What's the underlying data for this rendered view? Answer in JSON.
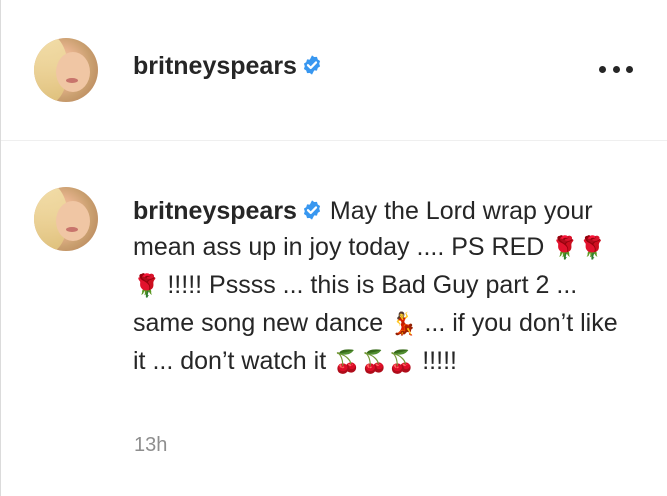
{
  "post_header": {
    "username": "britneyspears",
    "verified": true,
    "more_icon": "more-options-icon"
  },
  "comment": {
    "username": "britneyspears",
    "verified": true,
    "text_part1": "May the Lord wrap your mean ass up in joy today .... PS RED ",
    "emoji_roses": "🌹🌹🌹",
    "text_part2": " !!!!! Pssss ... this is Bad Guy part 2 ... same song new dance ",
    "emoji_dancer": "💃",
    "text_part3": " ... if you don’t like it ... don’t watch it ",
    "emoji_cherries": "🍒🍒🍒",
    "text_part4": " !!!!!",
    "timestamp": "13h"
  },
  "colors": {
    "verified_badge": "#3897f0",
    "text": "#262626",
    "muted": "#8e8e8e",
    "divider": "#efefef"
  }
}
